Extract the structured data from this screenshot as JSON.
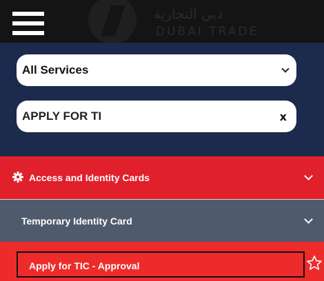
{
  "header": {
    "menu_icon": "hamburger-menu-icon",
    "logo_arabic": "دبي التجارية",
    "logo_english": "DUBAI TRADE"
  },
  "search_panel": {
    "service_select": {
      "selected": "All Services",
      "icon": "chevron-down-icon"
    },
    "search": {
      "value": "APPLY FOR TI",
      "clear_label": "x"
    }
  },
  "menu": {
    "category": {
      "label": "Access and Identity Cards",
      "icon": "gear-icon",
      "color": "#e0202a"
    },
    "subcategory": {
      "label": "Temporary Identity Card",
      "color": "#4f5a6d"
    },
    "service": {
      "label": "Apply for TIC - Approval",
      "icon": "star-outline-icon"
    }
  },
  "colors": {
    "header_bg": "#141414",
    "panel_bg": "#1b2a4d",
    "accent_red": "#e0202a"
  }
}
